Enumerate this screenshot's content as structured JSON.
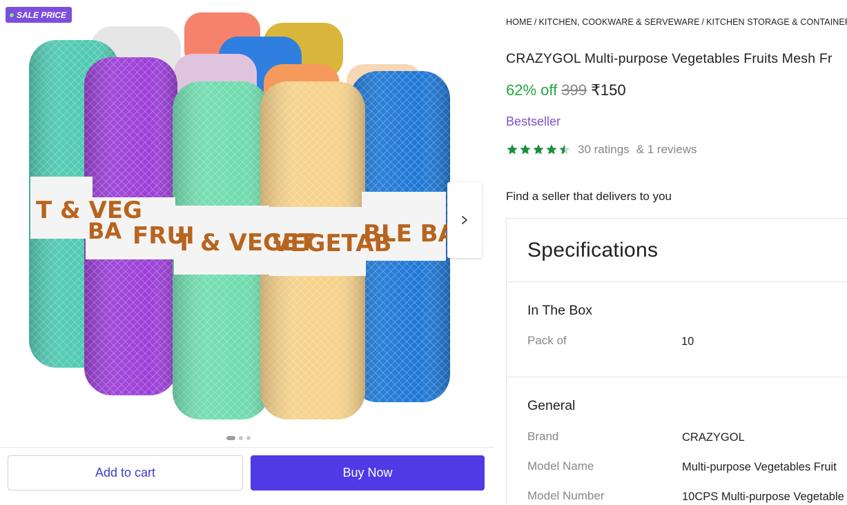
{
  "gallery": {
    "sale_badge": "SALE PRICE",
    "image_alt": "Rolled mesh vegetable and fruit bags in assorted colors",
    "band_texts": [
      "T & VEG",
      "BA",
      "FRUI",
      "T & VEGET",
      "VEGETAB",
      "BLE BA"
    ],
    "dots_count": 3,
    "active_dot": 0
  },
  "actions": {
    "add_to_cart": "Add to cart",
    "buy_now": "Buy Now"
  },
  "breadcrumb": [
    "HOME",
    "KITCHEN, COOKWARE & SERVEWARE",
    "KITCHEN STORAGE & CONTAINERS"
  ],
  "product": {
    "title": "CRAZYGOL Multi-purpose Vegetables Fruits Mesh Fr",
    "discount": "62% off",
    "mrp": "399",
    "price": "₹150",
    "bestseller": "Bestseller",
    "rating_value": 4.5,
    "ratings": "30 ratings",
    "reviews": "& 1 reviews",
    "seller_prompt": "Find a seller that delivers to you"
  },
  "specifications": {
    "title": "Specifications",
    "in_the_box": {
      "title": "In The Box",
      "rows": [
        {
          "key": "Pack of",
          "value": "10"
        }
      ]
    },
    "general": {
      "title": "General",
      "rows": [
        {
          "key": "Brand",
          "value": "CRAZYGOL"
        },
        {
          "key": "Model Name",
          "value": "Multi-purpose Vegetables Fruit"
        },
        {
          "key": "Model Number",
          "value": "10CPS Multi-purpose Vegetable"
        }
      ]
    }
  },
  "colors": {
    "accent": "#4f3ae6",
    "discount_green": "#26a541",
    "star_green": "#1e8e3e",
    "bestseller_purple": "#7e55c6",
    "sale_badge": "#7c4dde"
  },
  "icons": {
    "next": "chevron-right-icon",
    "star": "star-icon"
  }
}
